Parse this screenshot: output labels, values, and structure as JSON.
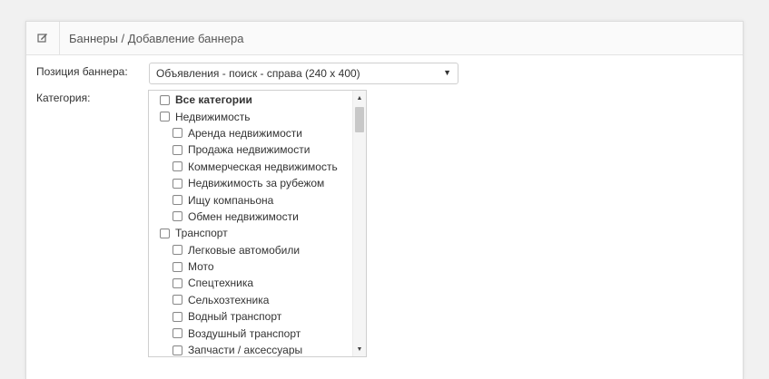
{
  "header": {
    "title": "Баннеры / Добавление баннера",
    "icon": "edit-icon"
  },
  "form": {
    "position_label": "Позиция баннера:",
    "position_value": "Объявления - поиск - справа (240 x 400)",
    "category_label": "Категория:"
  },
  "categories": [
    {
      "label": "Все категории",
      "level": 0,
      "bold": true
    },
    {
      "label": "Недвижимость",
      "level": 0
    },
    {
      "label": "Аренда недвижимости",
      "level": 1
    },
    {
      "label": "Продажа недвижимости",
      "level": 1
    },
    {
      "label": "Коммерческая недвижимость",
      "level": 1
    },
    {
      "label": "Недвижимость за рубежом",
      "level": 1
    },
    {
      "label": "Ищу компаньона",
      "level": 1
    },
    {
      "label": "Обмен недвижимости",
      "level": 1
    },
    {
      "label": "Транспорт",
      "level": 0
    },
    {
      "label": "Легковые автомобили",
      "level": 1
    },
    {
      "label": "Мото",
      "level": 1
    },
    {
      "label": "Спецтехника",
      "level": 1
    },
    {
      "label": "Сельхозтехника",
      "level": 1
    },
    {
      "label": "Водный транспорт",
      "level": 1
    },
    {
      "label": "Воздушный транспорт",
      "level": 1
    },
    {
      "label": "Запчасти / аксессуары",
      "level": 1
    }
  ]
}
